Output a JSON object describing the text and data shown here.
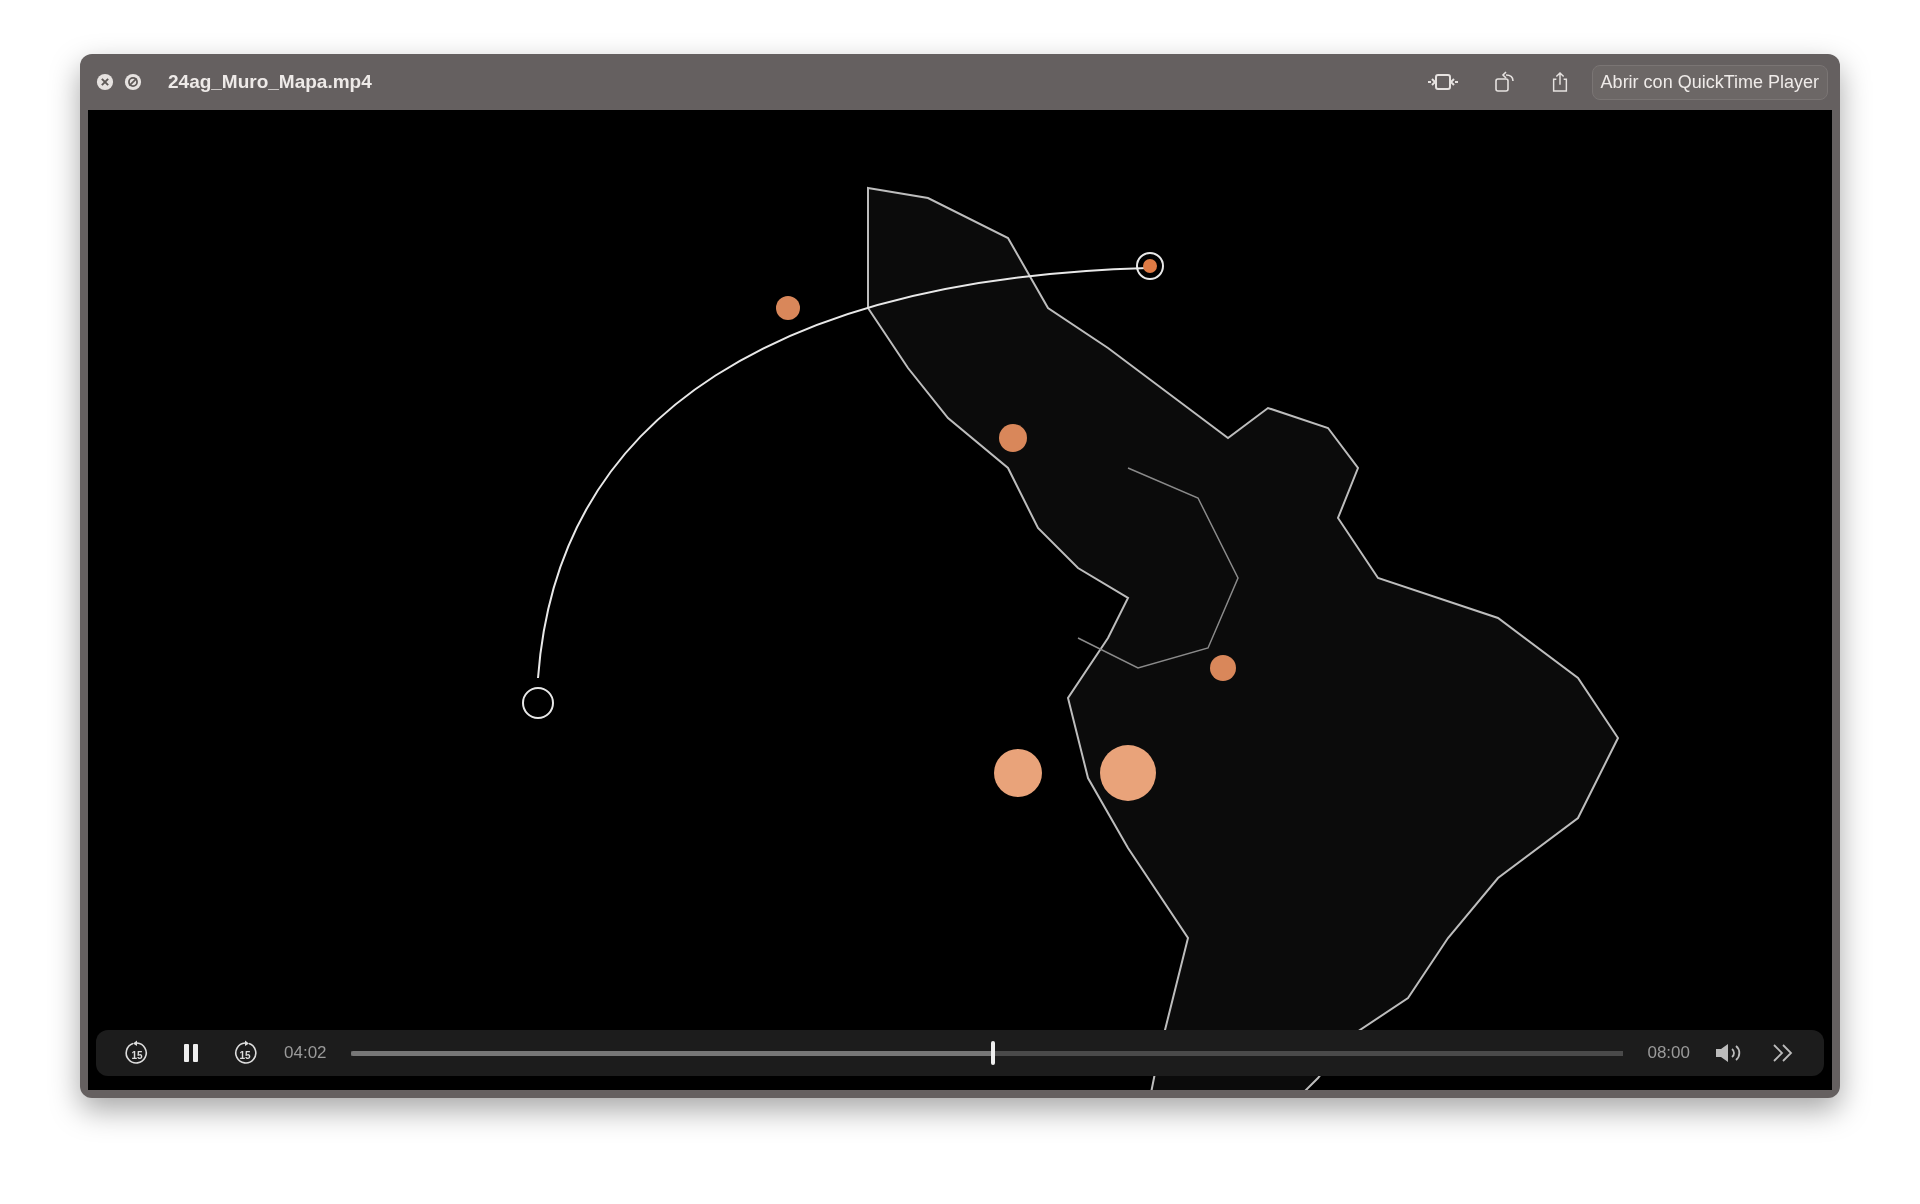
{
  "window": {
    "title": "24ag_Muro_Mapa.mp4"
  },
  "toolbar": {
    "open_button": "Abrir con QuickTime Player"
  },
  "controls": {
    "skip_back": "15",
    "playing": true,
    "skip_forward": "15",
    "elapsed": "04:02",
    "level": 0.505,
    "duration": "08:00"
  }
}
